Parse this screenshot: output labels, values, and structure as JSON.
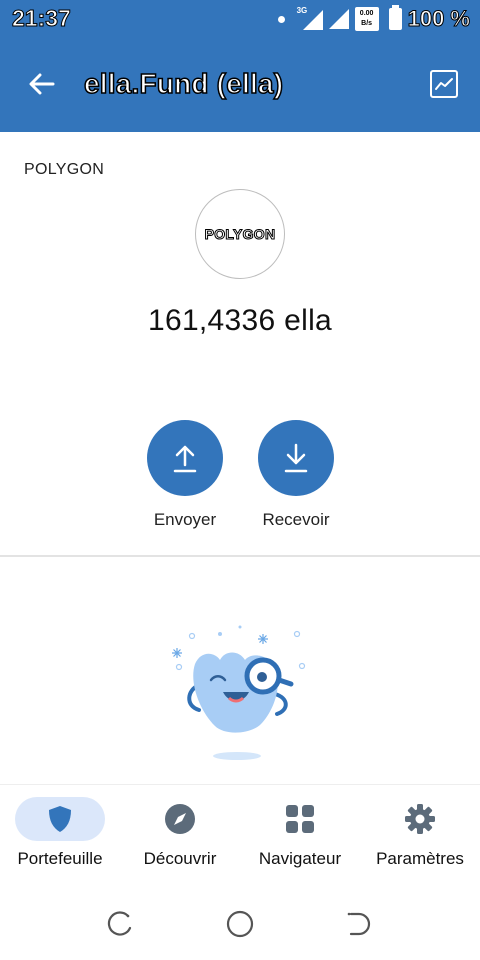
{
  "status_bar": {
    "time": "21:37",
    "network_type": "3G",
    "data_speed_top": "0.00",
    "data_speed_bottom": "B/s",
    "battery": "100 %"
  },
  "app_bar": {
    "title": "ella.Fund (ella)",
    "back_icon": "arrow-left-icon",
    "chart_icon": "chart-line-icon"
  },
  "token": {
    "network": "POLYGON",
    "logo_text": "POLYGON",
    "balance": "161,4336 ella"
  },
  "actions": {
    "send_label": "Envoyer",
    "receive_label": "Recevoir"
  },
  "bottom_nav": {
    "items": [
      {
        "label": "Portefeuille",
        "icon": "shield-icon",
        "active": true
      },
      {
        "label": "Découvrir",
        "icon": "compass-icon",
        "active": false
      },
      {
        "label": "Navigateur",
        "icon": "grid-icon",
        "active": false
      },
      {
        "label": "Paramètres",
        "icon": "gear-icon",
        "active": false
      }
    ]
  },
  "colors": {
    "primary": "#3375bb",
    "nav_active_bg": "#dbe7fa",
    "illustration_blue": "#a8cdf5"
  }
}
